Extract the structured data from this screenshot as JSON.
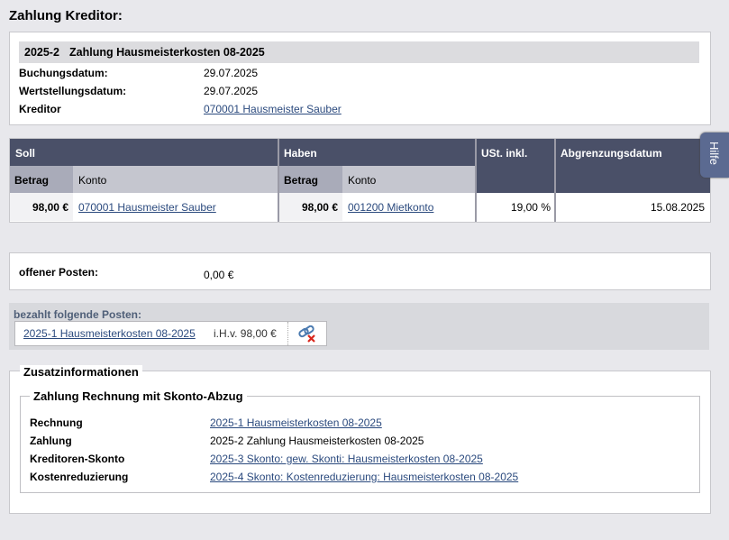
{
  "page_title": "Zahlung Kreditor:",
  "booking": {
    "number": "2025-2",
    "title": "Zahlung Hausmeisterkosten 08-2025",
    "fields": [
      {
        "label": "Buchungsdatum:",
        "value": "29.07.2025",
        "link": false
      },
      {
        "label": "Wertstellungsdatum:",
        "value": "29.07.2025",
        "link": false
      },
      {
        "label": "Kreditor",
        "value": "070001 Hausmeister Sauber",
        "link": true
      }
    ]
  },
  "split_table": {
    "soll_header": "Soll",
    "haben_header": "Haben",
    "ust_header": "USt. inkl.",
    "abgrenzung_header": "Abgrenzungsdatum",
    "betrag_header": "Betrag",
    "konto_header": "Konto",
    "row": {
      "soll_betrag": "98,00 €",
      "soll_konto": "070001 Hausmeister Sauber",
      "haben_betrag": "98,00 €",
      "haben_konto": "001200 Mietkonto",
      "ust": "19,00 %",
      "abgrenzung": "15.08.2025"
    }
  },
  "open_items": {
    "label": "offener Posten:",
    "value": "0,00 €"
  },
  "paid_items": {
    "label": "bezahlt folgende Posten:",
    "items": [
      {
        "name": "2025-1 Hausmeisterkosten 08-2025",
        "amount": "i.H.v. 98,00 €"
      }
    ]
  },
  "extra_info": {
    "legend": "Zusatzinformationen",
    "sub_legend": "Zahlung Rechnung mit Skonto-Abzug",
    "rows": [
      {
        "label": "Rechnung",
        "value": "2025-1 Hausmeisterkosten 08-2025",
        "link": true
      },
      {
        "label": "Zahlung",
        "value": "2025-2 Zahlung Hausmeisterkosten 08-2025",
        "link": false
      },
      {
        "label": "Kreditoren-Skonto",
        "value": "2025-3 Skonto: gew. Skonti: Hausmeisterkosten 08-2025",
        "link": true
      },
      {
        "label": "Kostenreduzierung",
        "value": "2025-4 Skonto: Kostenreduzierung: Hausmeisterkosten 08-2025",
        "link": true
      }
    ]
  },
  "help_tab": "Hilfe",
  "colors": {
    "header_dark": "#4a5068",
    "header_light": "#c5c6cf",
    "link": "#2b4a7e",
    "help_tab": "#5b6a91"
  }
}
